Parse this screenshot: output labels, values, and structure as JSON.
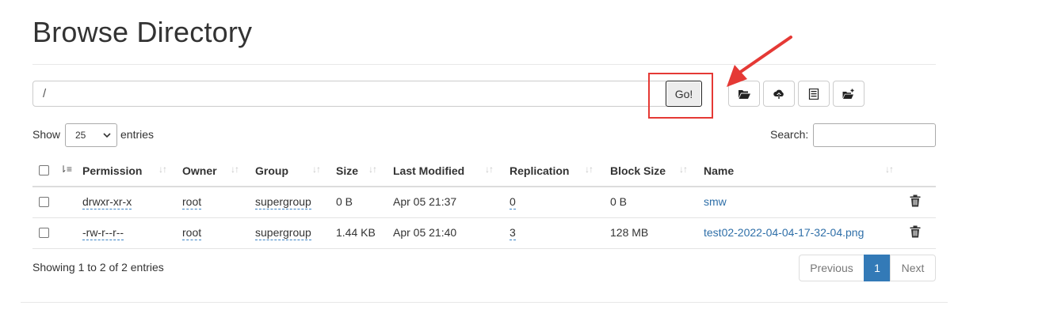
{
  "page": {
    "title": "Browse Directory"
  },
  "toolbar": {
    "path_value": "/",
    "go_label": "Go!",
    "icons": [
      "folder-open-icon",
      "upload-icon",
      "list-icon",
      "new-folder-icon"
    ]
  },
  "annotation": {
    "highlight_color": "#e53935",
    "arrow_color": "#e53935"
  },
  "table_controls": {
    "show_label": "Show",
    "page_length": "25",
    "entries_label": "entries",
    "search_label": "Search:"
  },
  "table": {
    "columns": [
      "Permission",
      "Owner",
      "Group",
      "Size",
      "Last Modified",
      "Replication",
      "Block Size",
      "Name"
    ],
    "rows": [
      {
        "permission": "drwxr-xr-x",
        "owner": "root",
        "group": "supergroup",
        "size": "0 B",
        "modified": "Apr 05 21:37",
        "replication": "0",
        "block_size": "0 B",
        "name": "smw"
      },
      {
        "permission": "-rw-r--r--",
        "owner": "root",
        "group": "supergroup",
        "size": "1.44 KB",
        "modified": "Apr 05 21:40",
        "replication": "3",
        "block_size": "128 MB",
        "name": "test02-2022-04-04-17-32-04.png"
      }
    ]
  },
  "footer": {
    "info": "Showing 1 to 2 of 2 entries",
    "prev_label": "Previous",
    "current_page": "1",
    "next_label": "Next"
  },
  "colors": {
    "link": "#2f6fa8",
    "pager_active": "#337ab7"
  }
}
